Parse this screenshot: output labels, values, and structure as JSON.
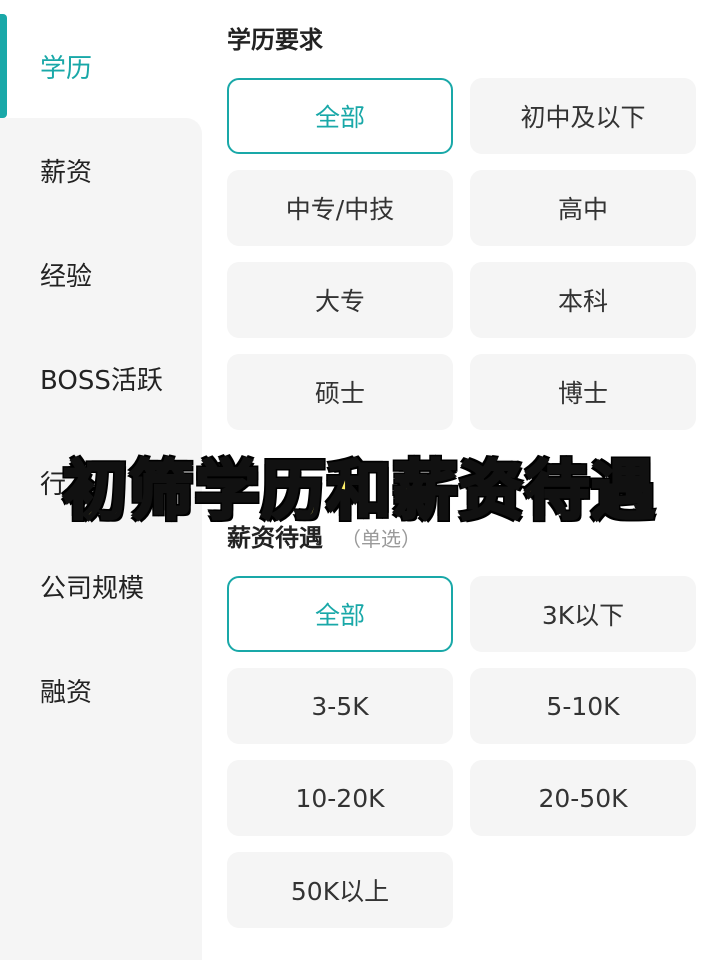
{
  "sidebar": {
    "items": [
      {
        "label": "学历",
        "active": true
      },
      {
        "label": "薪资",
        "active": false
      },
      {
        "label": "经验",
        "active": false
      },
      {
        "label": "BOSS活跃",
        "active": false
      },
      {
        "label": "行",
        "active": false
      },
      {
        "label": "公司规模",
        "active": false
      },
      {
        "label": "融资",
        "active": false
      }
    ]
  },
  "education": {
    "title": "学历要求",
    "options": [
      "全部",
      "初中及以下",
      "中专/中技",
      "高中",
      "大专",
      "本科",
      "硕士",
      "博士"
    ],
    "selected": "全部"
  },
  "salary": {
    "title": "薪资待遇",
    "hint": "（单选）",
    "options": [
      "全部",
      "3K以下",
      "3-5K",
      "5-10K",
      "10-20K",
      "20-50K",
      "50K以上"
    ],
    "selected": "全部"
  },
  "overlay": {
    "caption": "初筛学历和薪资待遇"
  },
  "colors": {
    "accent": "#19a8a8",
    "caption_fill": "#fff06a",
    "caption_stroke": "#111111",
    "option_bg": "#f5f5f5"
  }
}
